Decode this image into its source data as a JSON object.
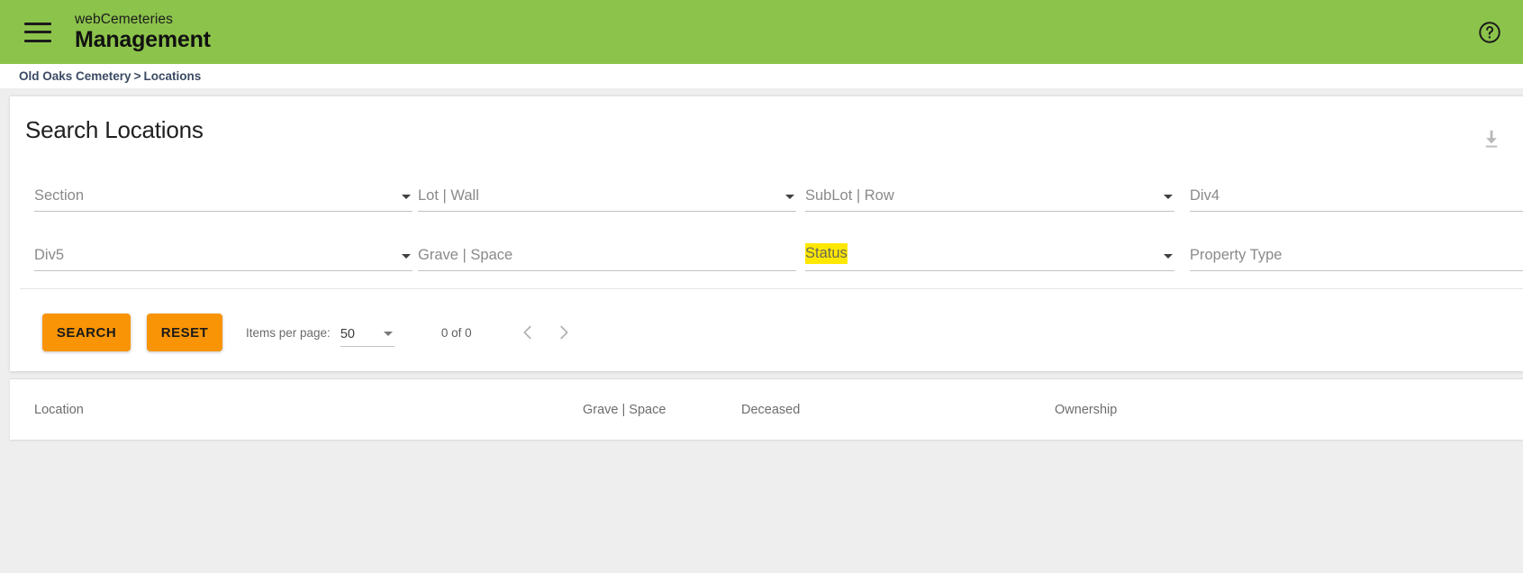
{
  "appbar": {
    "menu_icon": "hamburger-menu-icon",
    "brand_top": "webCemeteries",
    "brand_main": "Management",
    "help_icon": "help-circle-icon"
  },
  "breadcrumb": {
    "root": "Old Oaks Cemetery",
    "separator": ">",
    "current": "Locations"
  },
  "card": {
    "title": "Search Locations",
    "download_icon": "download-icon"
  },
  "form": {
    "row1": [
      {
        "label": "Section",
        "type": "select",
        "value": "",
        "arrow": true
      },
      {
        "label": "Lot | Wall",
        "type": "select",
        "value": "",
        "arrow": true
      },
      {
        "label": "SubLot | Row",
        "type": "select",
        "value": "",
        "arrow": true
      },
      {
        "label": "Div4",
        "type": "select",
        "value": "",
        "arrow": true
      }
    ],
    "row2": [
      {
        "label": "Div5",
        "type": "select",
        "value": "",
        "arrow": true
      },
      {
        "label": "Grave | Space",
        "type": "text",
        "value": "",
        "arrow": false
      },
      {
        "label": "Status",
        "type": "select",
        "value": "",
        "arrow": true,
        "highlighted": true,
        "highlight_color": "#ffe800"
      },
      {
        "label": "Property Type",
        "type": "text",
        "value": "",
        "arrow": false
      }
    ]
  },
  "actions": {
    "search_label": "SEARCH",
    "reset_label": "RESET",
    "button_color": "#f89406"
  },
  "paginator": {
    "items_per_page_label": "Items per page:",
    "items_per_page_value": "50",
    "range_label": "0 of 0",
    "prev_icon": "chevron-left-icon",
    "next_icon": "chevron-right-icon"
  },
  "results": {
    "columns": [
      "Location",
      "Grave | Space",
      "Deceased",
      "Ownership"
    ],
    "rows": []
  },
  "theme": {
    "appbar_green": "#8cc34b",
    "page_bg": "#eeeeee",
    "breadcrumb_blue": "#3b4a63"
  }
}
